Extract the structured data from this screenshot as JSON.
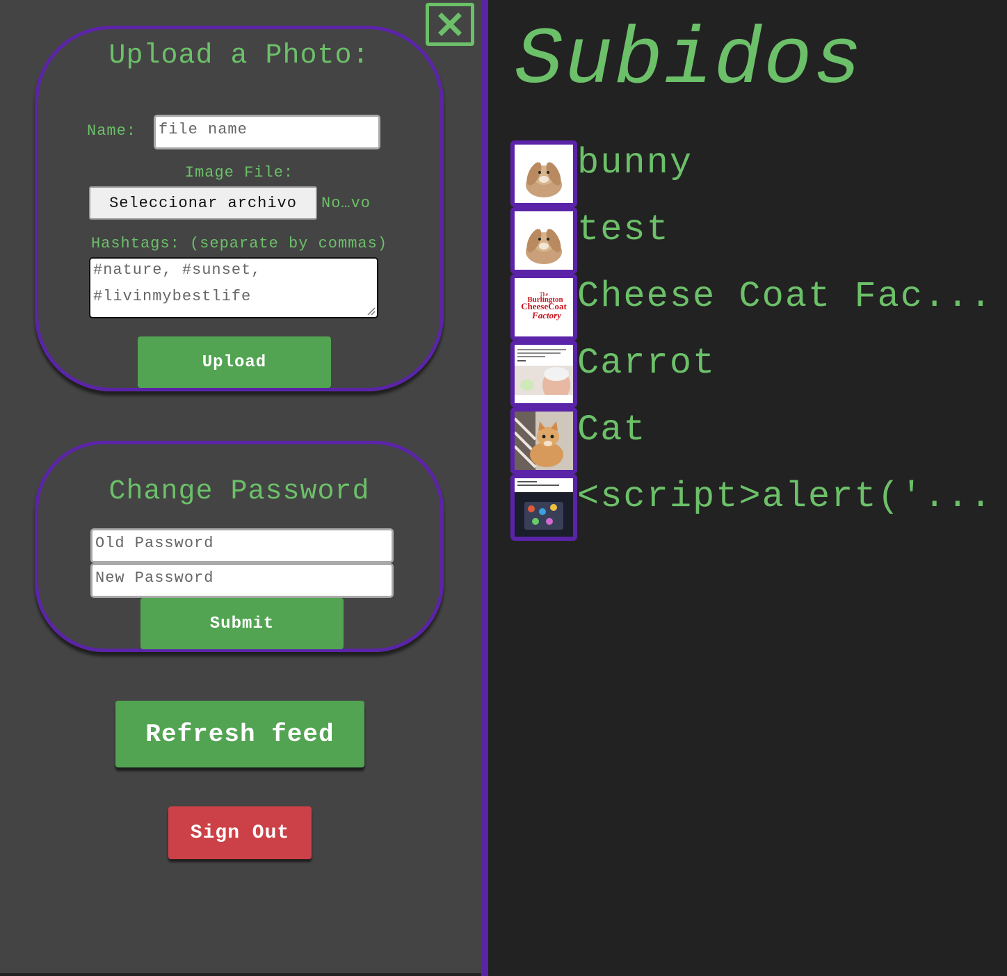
{
  "colors": {
    "accent_green": "#6cc069",
    "border_purple": "#5b24a8",
    "button_green": "#52a452",
    "button_red": "#cc4147",
    "panel_bg": "#444444",
    "page_bg": "#222222"
  },
  "close_button": {
    "icon": "close-icon"
  },
  "upload_form": {
    "title": "Upload a Photo:",
    "name_label": "Name:",
    "name_placeholder": "file name",
    "image_file_label": "Image File:",
    "file_button_label": "Seleccionar archivo",
    "file_status": "No…vo",
    "hashtags_label": "Hashtags: (separate by commas)",
    "hashtags_placeholder_line1": "#nature, #sunset,",
    "hashtags_placeholder_line2": "#livinmybestlife",
    "upload_button": "Upload"
  },
  "password_form": {
    "title": "Change Password",
    "old_placeholder": "Old Password",
    "new_placeholder": "New Password",
    "submit_button": "Submit"
  },
  "actions": {
    "refresh_button": "Refresh feed",
    "sign_out_button": "Sign Out"
  },
  "uploads": {
    "title": "Subidos",
    "items": [
      {
        "name": "bunny",
        "thumb": "bunny-thumbnail"
      },
      {
        "name": "test",
        "thumb": "bunny-thumbnail"
      },
      {
        "name": "Cheese Coat Fac...",
        "thumb": "cheesecoat-logo-thumbnail",
        "logo_text": [
          "The",
          "Burlington",
          "CheeseCoat",
          "Factory"
        ]
      },
      {
        "name": "Carrot",
        "thumb": "meme-screenshot-thumbnail"
      },
      {
        "name": "Cat",
        "thumb": "cat-photo-thumbnail"
      },
      {
        "name": "<script>alert('...",
        "thumb": "laptop-meme-thumbnail"
      }
    ]
  }
}
